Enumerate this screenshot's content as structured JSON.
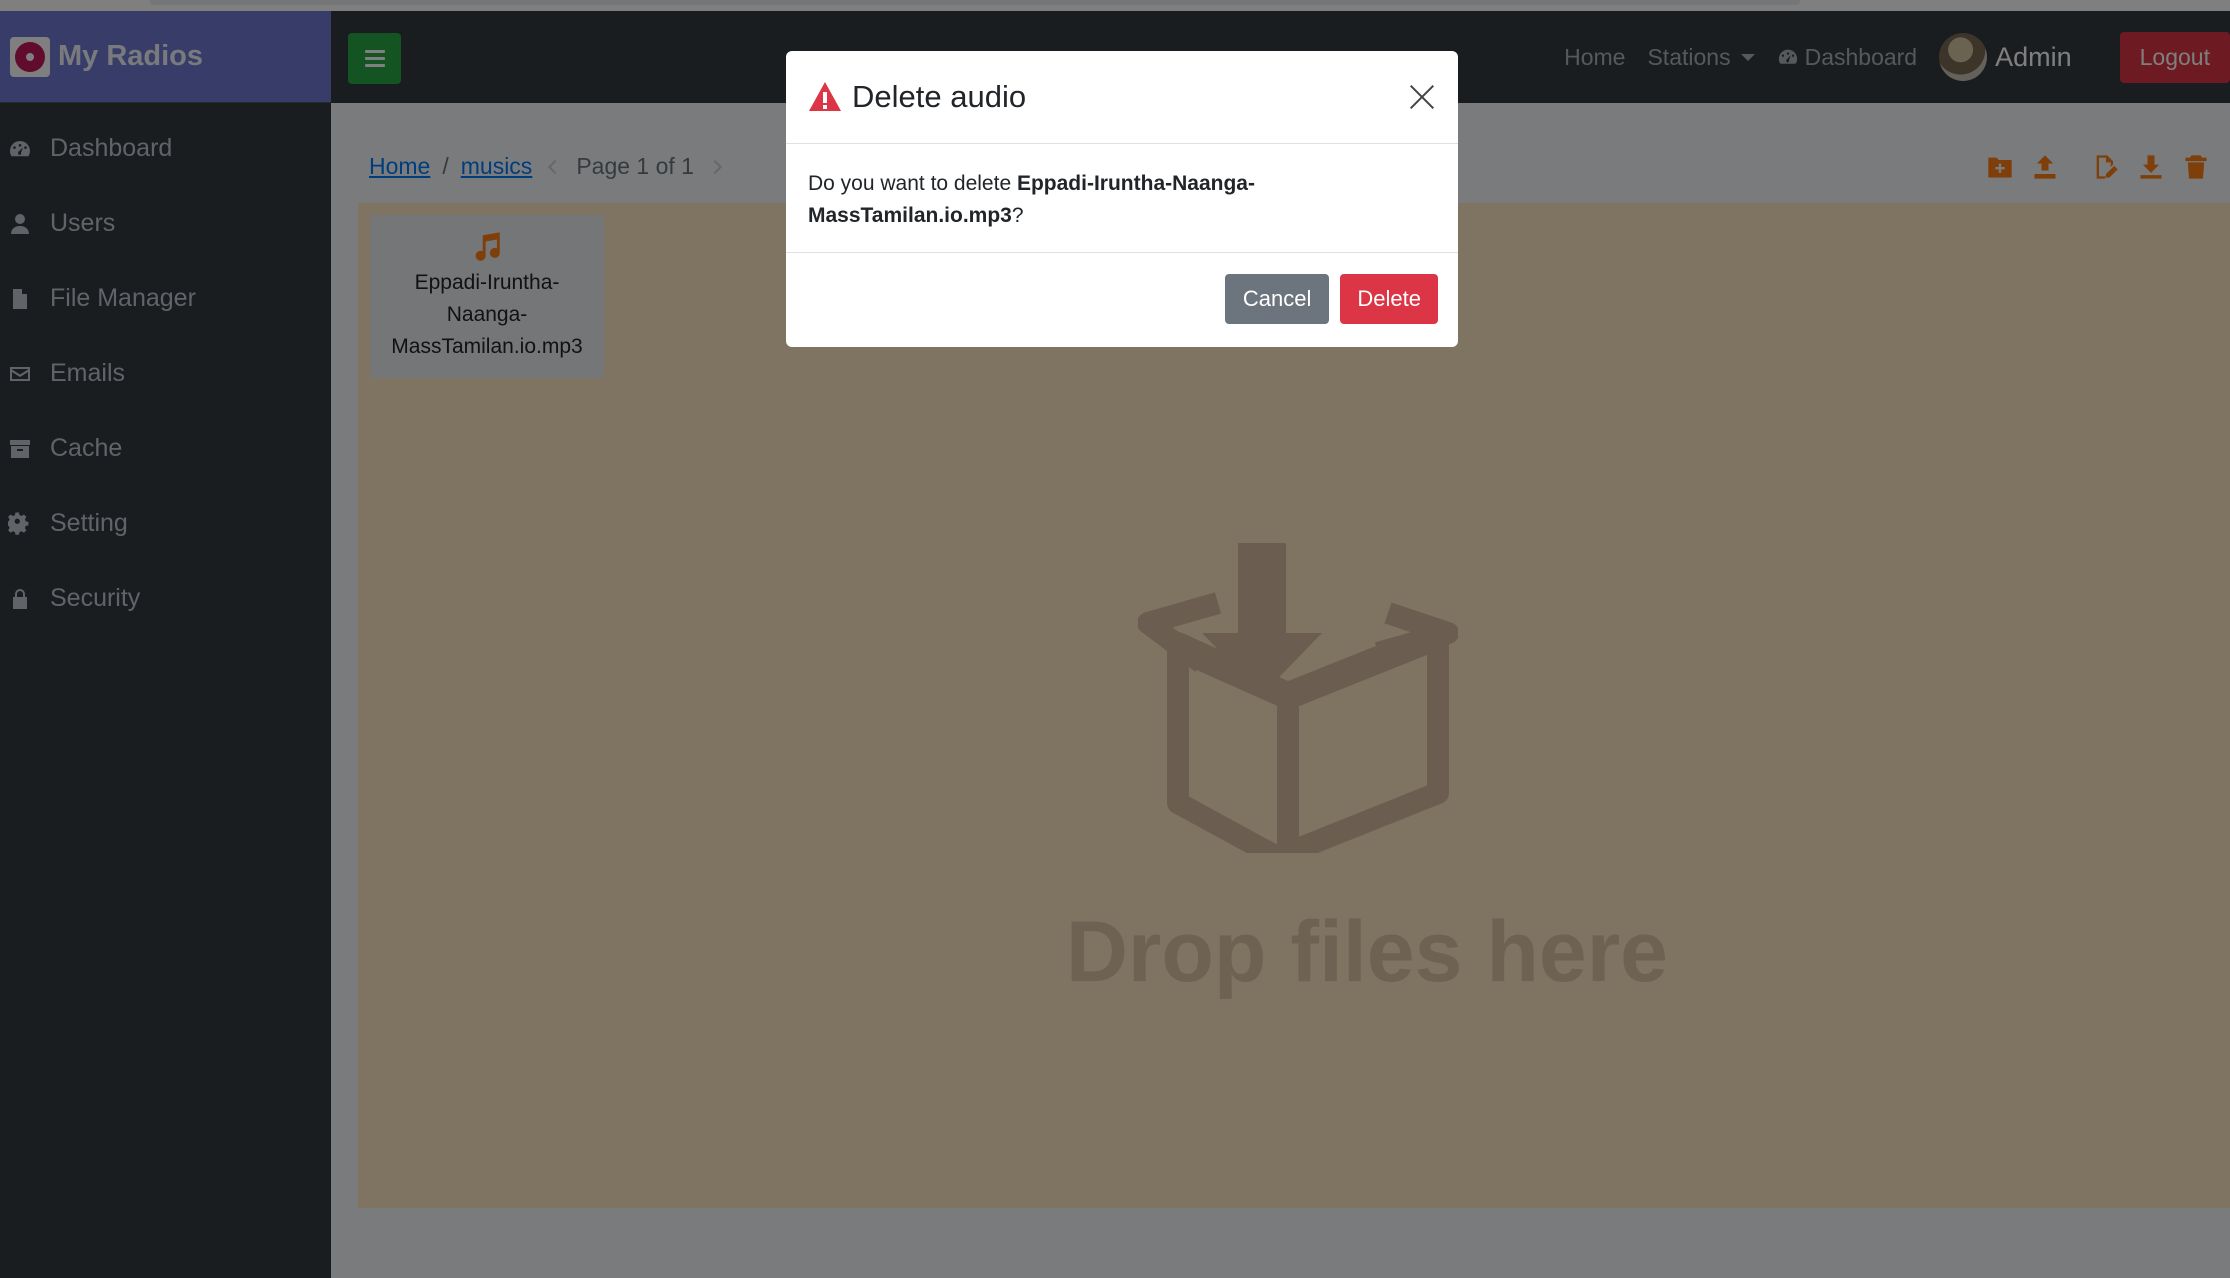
{
  "brand": {
    "title": "My Radios"
  },
  "sidebar": {
    "items": [
      {
        "label": "Dashboard",
        "icon": "tachometer-icon"
      },
      {
        "label": "Users",
        "icon": "user-icon"
      },
      {
        "label": "File Manager",
        "icon": "file-icon"
      },
      {
        "label": "Emails",
        "icon": "envelope-icon"
      },
      {
        "label": "Cache",
        "icon": "archive-icon"
      },
      {
        "label": "Setting",
        "icon": "gear-icon"
      },
      {
        "label": "Security",
        "icon": "lock-icon"
      }
    ]
  },
  "topnav": {
    "home": "Home",
    "stations": "Stations",
    "dashboard": "Dashboard",
    "user": "Admin",
    "logout": "Logout"
  },
  "breadcrumb": {
    "home": "Home",
    "folder": "musics",
    "page": "Page 1 of 1"
  },
  "files": [
    {
      "name": "Eppadi-Iruntha-Naanga-MassTamilan.io.mp3",
      "icon": "music-note-icon"
    }
  ],
  "dropzone": {
    "text": "Drop files here"
  },
  "modal": {
    "title": "Delete audio",
    "body_prefix": "Do you want to delete ",
    "filename": "Eppadi-Iruntha-Naanga-MassTamilan.io.mp3",
    "body_suffix": "?",
    "cancel": "Cancel",
    "delete": "Delete"
  },
  "colors": {
    "accent": "#fd7e14",
    "danger": "#dc3545",
    "success": "#28a745",
    "link": "#007bff",
    "sidebar": "#343a40"
  }
}
